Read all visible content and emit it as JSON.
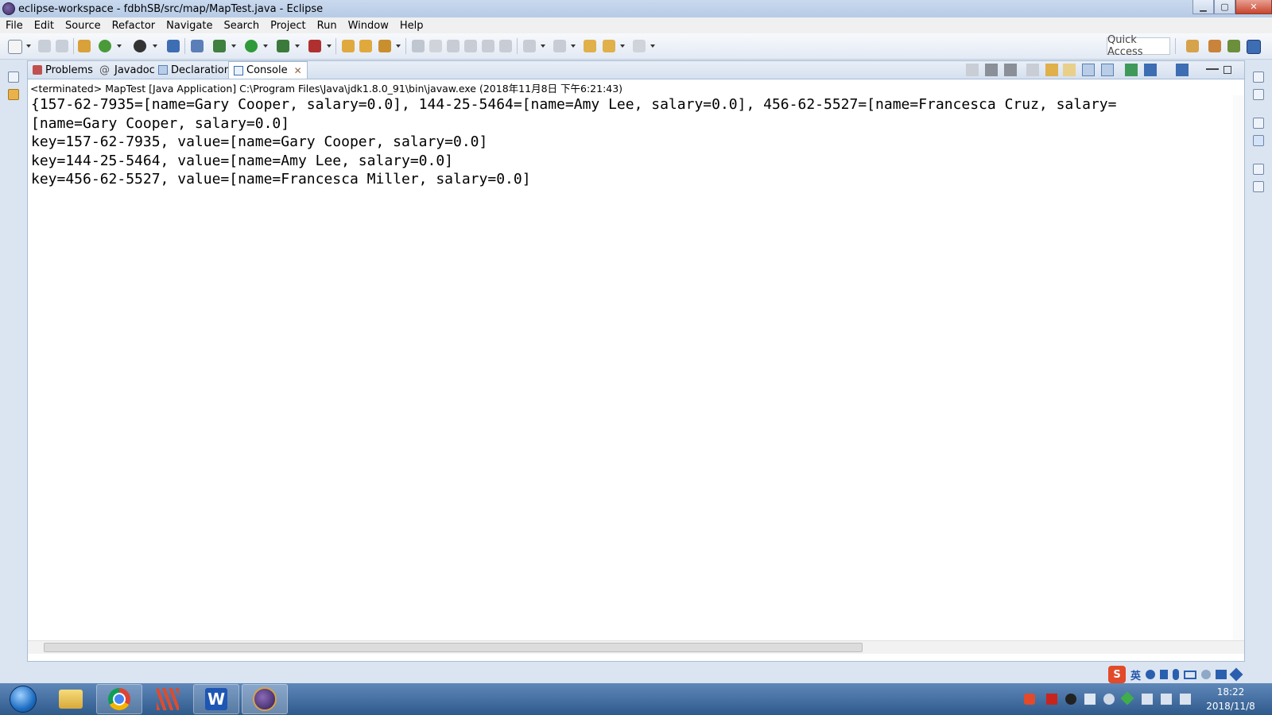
{
  "window": {
    "title": "eclipse-workspace - fdbhSB/src/map/MapTest.java - Eclipse",
    "controls": {
      "minimize": "▁",
      "maximize": "▢",
      "close": "✕"
    }
  },
  "menu": [
    "File",
    "Edit",
    "Source",
    "Refactor",
    "Navigate",
    "Search",
    "Project",
    "Run",
    "Window",
    "Help"
  ],
  "quick_access": "Quick Access",
  "tabs": [
    {
      "label": "Problems",
      "icon": "problems-icon"
    },
    {
      "label": "Javadoc",
      "icon": "at-icon",
      "glyph": "@"
    },
    {
      "label": "Declaration",
      "icon": "declaration-icon"
    },
    {
      "label": "Console",
      "icon": "console-icon",
      "active": true,
      "close": "✕"
    }
  ],
  "console": {
    "status": "<terminated> MapTest [Java Application] C:\\Program Files\\Java\\jdk1.8.0_91\\bin\\javaw.exe (2018年11月8日 下午6:21:43)",
    "lines": [
      "{157-62-7935=[name=Gary Cooper, salary=0.0], 144-25-5464=[name=Amy Lee, salary=0.0], 456-62-5527=[name=Francesca Cruz, salary=",
      "[name=Gary Cooper, salary=0.0]",
      "key=157-62-7935, value=[name=Gary Cooper, salary=0.0]",
      "key=144-25-5464, value=[name=Amy Lee, salary=0.0]",
      "key=456-62-5527, value=[name=Francesca Miller, salary=0.0]"
    ]
  },
  "ime": {
    "logo": "S",
    "lang": "英"
  },
  "taskbar": {
    "apps": [
      "start-orb",
      "file-explorer",
      "chrome",
      "app-stripes",
      "wps-writer",
      "eclipse"
    ],
    "clock_time": "18:22",
    "clock_date": "2018/11/8"
  },
  "colors": {
    "accent": "#2f5a8c",
    "panel_border": "#a8bcd6",
    "close": "#c7452d"
  }
}
